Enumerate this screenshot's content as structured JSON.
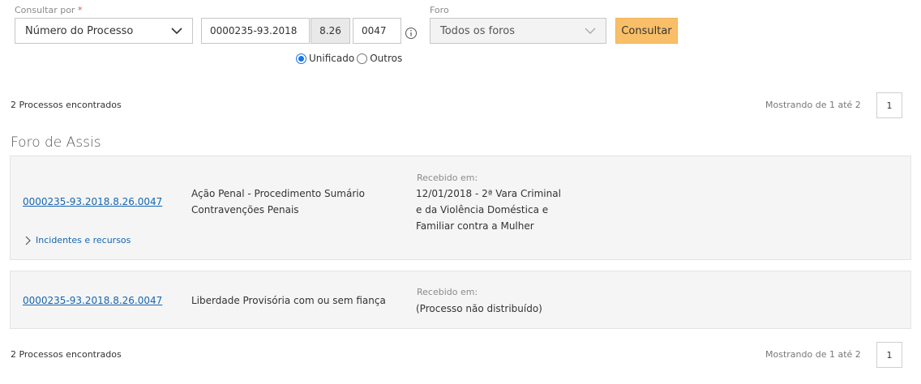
{
  "search": {
    "consultar_por_label": "Consultar por",
    "required_mark": "*",
    "consultar_por_value": "Número do Processo",
    "numero_value": "0000235-93.2018",
    "segment_value": "8.26",
    "origem_value": "0047",
    "radio_unificado": "Unificado",
    "radio_outros": "Outros",
    "foro_label": "Foro",
    "foro_value": "Todos os foros",
    "button_label": "Consultar"
  },
  "results": {
    "count_text": "2 Processos encontrados",
    "showing_text": "Mostrando de 1 até 2",
    "page_number": "1",
    "foro_title": "Foro de Assis",
    "items": [
      {
        "numero": "0000235-93.2018.8.26.0047",
        "classe_line1": "Ação Penal - Procedimento Sumário",
        "classe_line2": "Contravenções Penais",
        "recebido_label": "Recebido em:",
        "recebido_line1": "12/01/2018 - 2ª Vara Criminal",
        "recebido_line2": "e da Violência Doméstica e",
        "recebido_line3": "Familiar contra a Mulher",
        "incidentes_label": "Incidentes e recursos"
      },
      {
        "numero": "0000235-93.2018.8.26.0047",
        "classe_line1": "Liberdade Provisória com ou sem fiança",
        "recebido_label": "Recebido em:",
        "recebido_line1": "(Processo não distribuído)"
      }
    ]
  },
  "colors": {
    "link": "#1666b0",
    "button": "#f9bf68",
    "required": "#d9534f",
    "radio_selected": "#1a73e8"
  },
  "icons": [
    "chevron-down-icon",
    "info-icon",
    "chevron-right-icon"
  ]
}
